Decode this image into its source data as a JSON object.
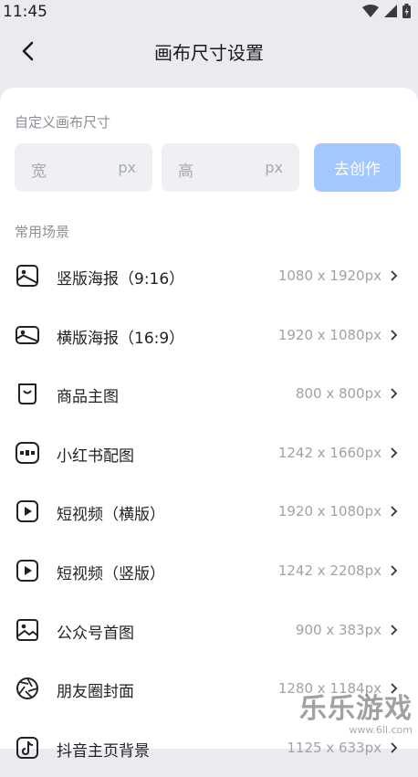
{
  "status": {
    "time": "11:45"
  },
  "header": {
    "title": "画布尺寸设置"
  },
  "custom": {
    "label": "自定义画布尺寸",
    "width_placeholder": "宽",
    "height_placeholder": "高",
    "unit": "px",
    "create_label": "去创作"
  },
  "scenes": {
    "label": "常用场景",
    "items": [
      {
        "name": "竖版海报（9:16）",
        "size": "1080 x 1920px",
        "icon": "portrait-poster-icon"
      },
      {
        "name": "横版海报（16:9）",
        "size": "1920 x 1080px",
        "icon": "landscape-poster-icon"
      },
      {
        "name": "商品主图",
        "size": "800 x 800px",
        "icon": "shopping-bag-icon"
      },
      {
        "name": "小红书配图",
        "size": "1242 x 1660px",
        "icon": "xiaohongshu-icon"
      },
      {
        "name": "短视频（横版）",
        "size": "1920 x 1080px",
        "icon": "video-play-icon"
      },
      {
        "name": "短视频（竖版）",
        "size": "1242 x 2208px",
        "icon": "video-play-icon"
      },
      {
        "name": "公众号首图",
        "size": "900 x 383px",
        "icon": "image-icon"
      },
      {
        "name": "朋友圈封面",
        "size": "1280 x 1184px",
        "icon": "aperture-icon"
      },
      {
        "name": "抖音主页背景",
        "size": "1125 x 633px",
        "icon": "douyin-icon"
      }
    ]
  },
  "watermark": {
    "text": "乐乐游戏",
    "url": "www.6ll.com"
  }
}
